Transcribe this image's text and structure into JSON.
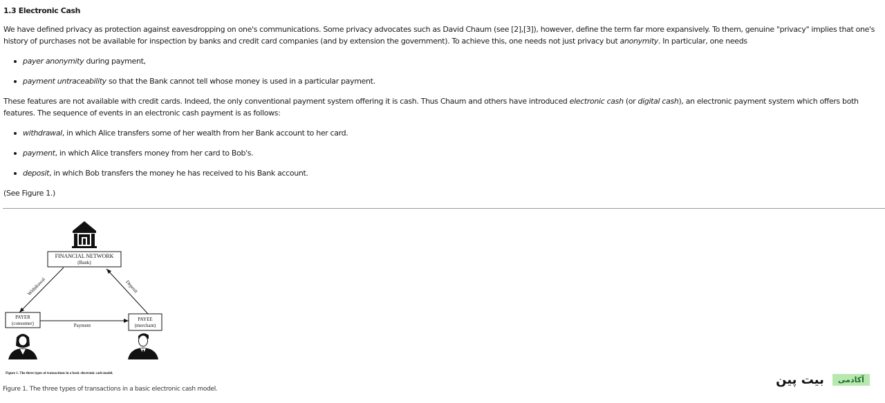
{
  "section": {
    "heading": "1.3 Electronic Cash"
  },
  "para1": {
    "t1": "We have defined privacy as protection against eavesdropping on one's communications. Some privacy advocates such as David Chaum (see [2],[3]), however, define the term far more expansively. To them, genuine \"privacy\" implies that one's history of purchases not be available for inspection by banks and credit card companies (and by extension the government). To achieve this, one needs not just privacy but ",
    "em1": "anonymity",
    "t2": ". In particular, one needs"
  },
  "needs": [
    {
      "em": "payer anonymity",
      "text": " during payment,"
    },
    {
      "em": "payment untraceability",
      "text": " so that the Bank cannot tell whose money is used in a particular payment."
    }
  ],
  "para2": {
    "t1": "These features are not available with credit cards. Indeed, the only conventional payment system offering it is cash. Thus Chaum and others have introduced ",
    "em1": "electronic cash",
    "t2": " (or ",
    "em2": "digital cash",
    "t3": "), an electronic payment system which offers both features. The sequence of events in an electronic cash payment is as follows:"
  },
  "steps": [
    {
      "em": "withdrawal",
      "text": ", in which Alice transfers some of her wealth from her Bank account to her card."
    },
    {
      "em": "payment",
      "text": ", in which Alice transfers money from her card to Bob's."
    },
    {
      "em": "deposit",
      "text": ", in which Bob transfers the money he has received to his Bank account."
    }
  ],
  "see_figure": "(See Figure 1.)",
  "figure": {
    "bank_line1": "FINANCIAL NETWORK",
    "bank_line2": "(Bank)",
    "payer_line1": "PAYER",
    "payer_line2": "(consumer)",
    "payee_line1": "PAYEE",
    "payee_line2": "(merchant)",
    "edge_withdrawal": "Withdrawal",
    "edge_deposit": "Deposit",
    "edge_payment": "Payment",
    "inner_caption": "Figure 1. The three types of transactions in a basic electronic cash model.",
    "icons": [
      "bank-building-icon",
      "consumer-person-icon",
      "merchant-person-icon"
    ]
  },
  "caption": "Figure 1. The three types of transactions in a basic electronic cash model.",
  "logo": {
    "badge": "آکادمی",
    "word": "بیت پین",
    "badge_color": "#b8e8b0"
  }
}
